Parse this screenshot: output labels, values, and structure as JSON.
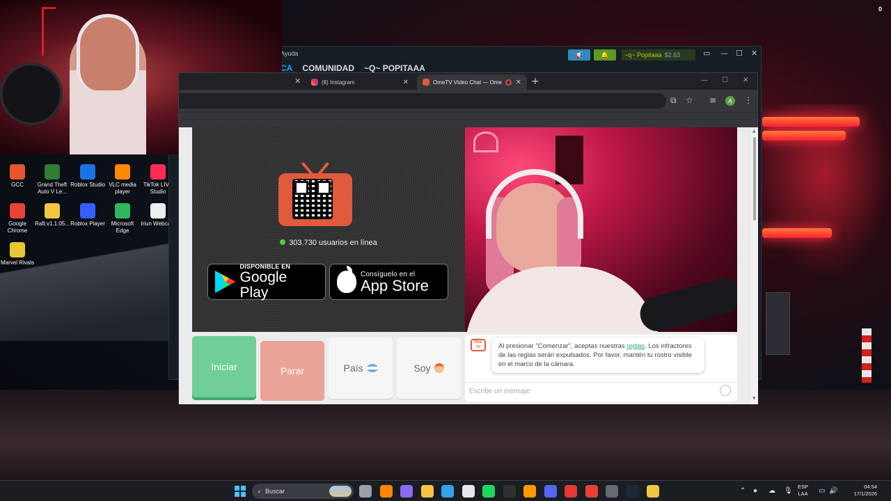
{
  "overlay": {
    "counter": "0"
  },
  "steam": {
    "help_menu": "Ayuda",
    "nav": [
      "CA",
      "COMUNIDAD",
      "~Q~ POPITAAA"
    ],
    "user_name": "~q~ Popitaaa",
    "wallet": "$2.63",
    "controls": [
      "▭",
      "—",
      "☐",
      "✕"
    ]
  },
  "browser": {
    "tabs": [
      {
        "label": "(8) Instagram",
        "icon": "instagram-icon"
      },
      {
        "label": "OmeTV Video Chat — Ome",
        "icon": "ometv-icon"
      }
    ],
    "new_tab": "+",
    "controls": [
      "—",
      "☐",
      "✕"
    ],
    "profile_initial": "A"
  },
  "ometv": {
    "online_count": "303.730 usuarios en línea",
    "google_play": {
      "small": "DISPONIBLE EN",
      "big": "Google Play"
    },
    "app_store": {
      "small": "Consíguelo en el",
      "big": "App Store"
    },
    "buttons": {
      "start": "Iniciar",
      "stop": "Parar",
      "country": "País",
      "gender": "Soy"
    },
    "logo_text": "Ome TV",
    "chat_message_before": "Al presionar \"Comenzar\", aceptas nuestras ",
    "chat_message_link": "reglas",
    "chat_message_after": ". Los infractores de las reglas serán expulsados. Por favor, mantén tu rostro visible en el marco de la cámara.",
    "message_placeholder": "Escribe un mensaje"
  },
  "desktop_icons": [
    {
      "label": "GCC",
      "color": "#e8552a"
    },
    {
      "label": "Grand Theft Auto V Le...",
      "color": "#2e7d32"
    },
    {
      "label": "Roblox Studio",
      "color": "#1a73e8"
    },
    {
      "label": "VLC media player",
      "color": "#ff8800"
    },
    {
      "label": "TikTok LIVE Studio",
      "color": "#fe2c55"
    },
    {
      "label": "Google Chrome",
      "color": "#e94235"
    },
    {
      "label": "Raft.v1.1.05...",
      "color": "#f4c542"
    },
    {
      "label": "Roblox Player",
      "color": "#335fff"
    },
    {
      "label": "Microsoft Edge",
      "color": "#2fb75b"
    },
    {
      "label": "Iriun Webcam",
      "color": "#eeeeee"
    },
    {
      "label": "Marvel Rivals",
      "color": "#e8c830"
    }
  ],
  "taskbar": {
    "search_placeholder": "Buscar",
    "lang_1": "ESP",
    "lang_2": "LAA",
    "time": "04:54",
    "date": "17/1/2026",
    "apps": [
      "#9aa0aa",
      "#ff8800",
      "#8a6cf0",
      "#f4c542",
      "#2fa4e7",
      "#e8e8e8",
      "#1ed760",
      "#303030",
      "#ff9a00",
      "#5865f2",
      "#e53935",
      "#e94235",
      "#666a70",
      "#1b2838",
      "#f4c542"
    ]
  },
  "colors": {
    "ometv_accent": "#e05a3c",
    "start_green": "#6fcf97",
    "stop_salmon": "#e9a497",
    "link": "#2aa870"
  }
}
